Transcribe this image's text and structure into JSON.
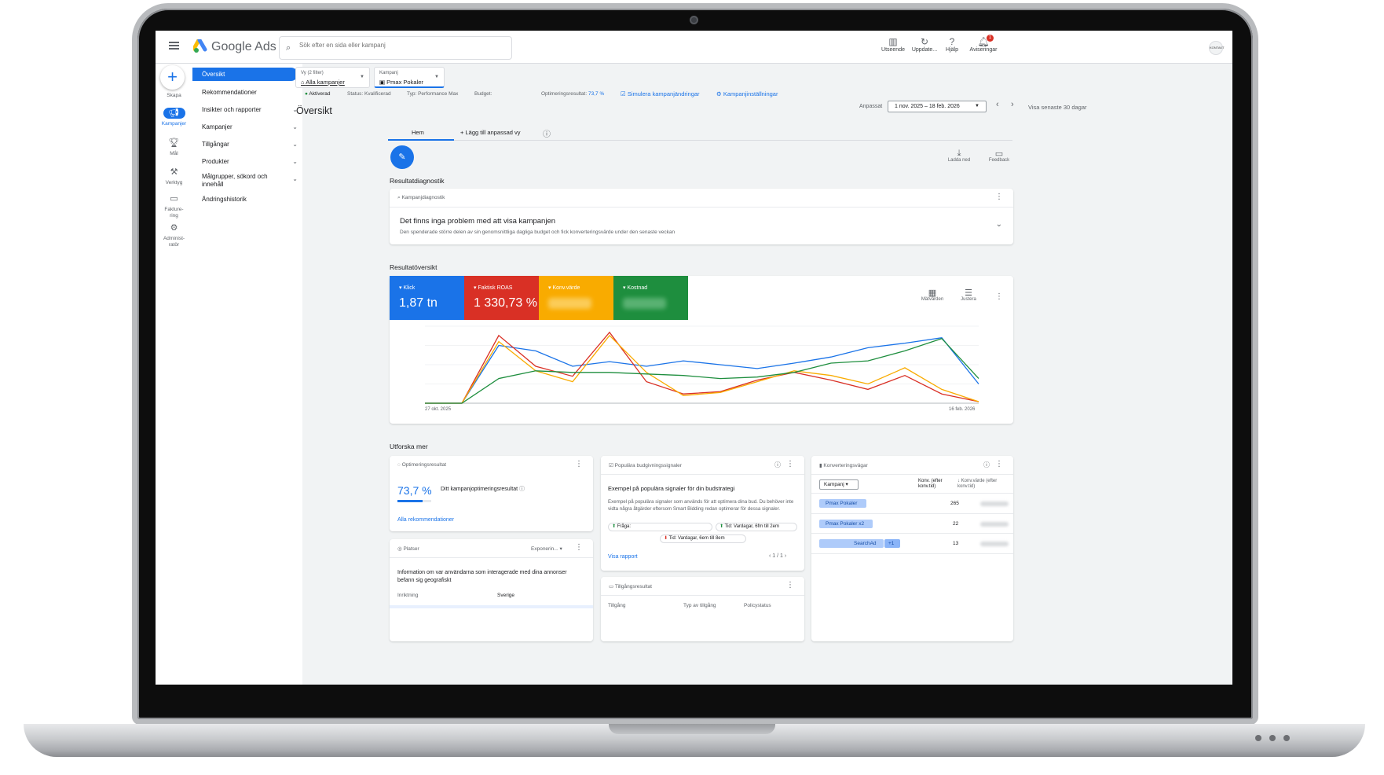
{
  "app": {
    "brand": "Google Ads",
    "search_placeholder": "Sök efter en sida eller kampanj"
  },
  "topbar": {
    "buttons": [
      {
        "label": "Utseende",
        "icon": "appearance-icon"
      },
      {
        "label": "Uppdate...",
        "icon": "refresh-icon"
      },
      {
        "label": "Hjälp",
        "icon": "help-icon"
      },
      {
        "label": "Aviseringar",
        "icon": "bell-icon",
        "badge": "1"
      }
    ],
    "avatar_text": "KONTAKT"
  },
  "rail": {
    "create_label": "Skapa",
    "items": [
      {
        "label": "Kampanjer",
        "icon": "megaphone-icon",
        "active": true
      },
      {
        "label": "Mål",
        "icon": "trophy-icon"
      },
      {
        "label": "Verktyg",
        "icon": "tools-icon"
      },
      {
        "label": "Fakture-ring",
        "icon": "billing-icon"
      },
      {
        "label": "Administ-ratör",
        "icon": "admin-gear-icon"
      }
    ]
  },
  "nav": {
    "items": [
      {
        "label": "Översikt",
        "active": true
      },
      {
        "label": "Rekommendationer"
      },
      {
        "label": "Insikter och rapporter",
        "expandable": true
      },
      {
        "label": "Kampanjer",
        "expandable": true
      },
      {
        "label": "Tillgångar",
        "expandable": true
      },
      {
        "label": "Produkter",
        "expandable": true
      },
      {
        "label": "Målgrupper, sökord och innehåll",
        "expandable": true
      },
      {
        "label": "Ändringshistorik"
      }
    ]
  },
  "filters": {
    "view": {
      "label": "Vy (2 filter)",
      "value": "Alla kampanjer"
    },
    "campaign": {
      "label": "Kampanj",
      "value": "Pmax Pokaler"
    }
  },
  "status": {
    "state": "Aktiverad",
    "status": "Status: Kvalificerad",
    "type": "Typ: Performance Max",
    "budget": "Budget:",
    "optimization_label": "Optimeringsresultat:",
    "optimization_value": "73,7 %",
    "simulate": "Simulera kampanjändringar",
    "settings": "Kampanjinställningar"
  },
  "page": {
    "title": "Översikt",
    "date_label": "Anpassat",
    "date_range": "1 nov. 2025 – 18 feb. 2026",
    "last30": "Visa senaste 30 dagar"
  },
  "tabs": {
    "home": "Hem",
    "add_custom": "Lägg till anpassad vy"
  },
  "actions": {
    "download": "Ladda ned",
    "feedback": "Feedback"
  },
  "diagnostics": {
    "section": "Resultatdiagnostik",
    "card_head": "Kampanjdiagnostik",
    "title": "Det finns inga problem med att visa kampanjen",
    "desc": "Den spenderade större delen av sin genomsnittliga dagliga budget och fick konverteringsvärde under den senaste veckan"
  },
  "overview": {
    "section": "Resultatöversikt",
    "metrics": [
      {
        "name": "Klick",
        "value": "1,87 tn",
        "color": "#1a73e8"
      },
      {
        "name": "Faktisk ROAS",
        "value": "1 330,73 %",
        "color": "#d93025"
      },
      {
        "name": "Konv.värde",
        "value": "",
        "color": "#f9ab00"
      },
      {
        "name": "Kostnad",
        "value": "",
        "color": "#1e8e3e"
      }
    ],
    "metric_btn": "Mätvärden",
    "adjust_btn": "Justera"
  },
  "chart_data": {
    "type": "line",
    "x_start_label": "27 okt. 2025",
    "x_end_label": "16 feb. 2026",
    "series": [
      {
        "color": "#1a73e8",
        "values": [
          0,
          0,
          75,
          68,
          48,
          54,
          48,
          55,
          50,
          45,
          52,
          60,
          72,
          78,
          85,
          25
        ]
      },
      {
        "color": "#d93025",
        "values": [
          0,
          0,
          88,
          48,
          35,
          92,
          28,
          12,
          15,
          30,
          40,
          30,
          18,
          36,
          12,
          2
        ]
      },
      {
        "color": "#f9ab00",
        "values": [
          0,
          0,
          80,
          42,
          28,
          88,
          40,
          10,
          14,
          28,
          42,
          36,
          25,
          46,
          18,
          2
        ]
      },
      {
        "color": "#1e8e3e",
        "values": [
          0,
          0,
          32,
          42,
          40,
          40,
          38,
          36,
          32,
          34,
          40,
          52,
          55,
          68,
          84,
          32
        ]
      }
    ]
  },
  "explore": {
    "section": "Utforska mer",
    "opt": {
      "head": "Optimeringsresultat",
      "value": "73,7 %",
      "label": "Ditt kampanjoptimeringsresultat",
      "progress": 0.737,
      "link": "Alla rekommendationer"
    },
    "signals": {
      "head": "Populära budgivningssignaler",
      "title": "Exempel på populära signaler för din budstrategi",
      "desc": "Exempel på populära signaler som används för att optimera dina bud. Du behöver inte vidta några åtgärder eftersom Smart Bidding redan optimerar för dessa signaler.",
      "signal1": "Fråga:",
      "signal2": "Tid: Vardagar, 6fm till 2em",
      "signal3": "Tid: Vardagar, 6em till 8em",
      "link": "Visa rapport",
      "pager": "1 / 1"
    },
    "paths": {
      "head": "Konverteringsvägar",
      "filter": "Kampanj",
      "col1": "Konv. (efter konv.tid)",
      "col2": "Konv.värde (efter konv.tid)",
      "rows": [
        {
          "path": "Pmax Pokaler",
          "conv": "265"
        },
        {
          "path": "Pmax Pokaler x2",
          "conv": "22"
        },
        {
          "path": "SearchAd",
          "extra": "+1",
          "conv": "13"
        }
      ]
    },
    "places": {
      "head": "Platser",
      "dropdown": "Exponerin...",
      "text": "Information om var användarna som interagerade med dina annonser befann sig geografiskt",
      "col1": "Inriktning",
      "col2": "Sverige"
    },
    "assets": {
      "head": "Tillgångsresultat",
      "col1": "Tillgång",
      "col2": "Typ av tillgång",
      "col3": "Policystatus"
    }
  }
}
